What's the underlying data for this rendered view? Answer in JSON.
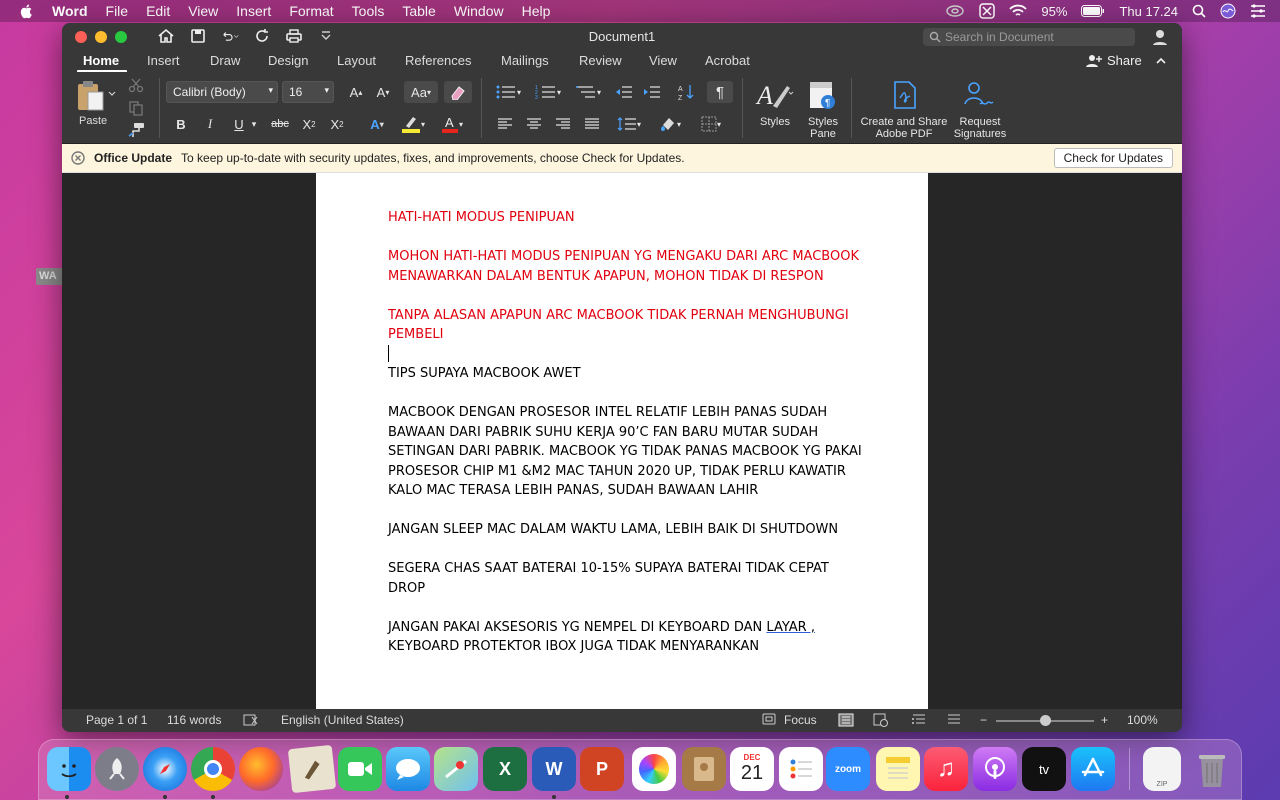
{
  "menubar": {
    "app": "Word",
    "items": [
      "File",
      "Edit",
      "View",
      "Insert",
      "Format",
      "Tools",
      "Table",
      "Window",
      "Help"
    ],
    "battery": "95%",
    "clock": "Thu 17.24"
  },
  "desktop_stub": "WA",
  "window": {
    "title": "Document1",
    "search_placeholder": "Search in Document"
  },
  "tabs": [
    "Home",
    "Insert",
    "Draw",
    "Design",
    "Layout",
    "References",
    "Mailings",
    "Review",
    "View",
    "Acrobat"
  ],
  "share_label": "Share",
  "ribbon": {
    "paste_label": "Paste",
    "font_name": "Calibri (Body)",
    "font_size": "16",
    "styles_label": "Styles",
    "styles_pane_label_1": "Styles",
    "styles_pane_label_2": "Pane",
    "adobe_label_1": "Create and Share",
    "adobe_label_2": "Adobe PDF",
    "sign_label_1": "Request",
    "sign_label_2": "Signatures"
  },
  "update_bar": {
    "title": "Office Update",
    "message": "To keep up-to-date with security updates, fixes, and improvements, choose Check for Updates.",
    "button": "Check for Updates"
  },
  "document": {
    "p1": "HATI-HATI MODUS PENIPUAN",
    "p2": "MOHON HATI-HATI MODUS PENIPUAN YG MENGAKU DARI ARC MACBOOK MENAWARKAN DALAM BENTUK APAPUN, MOHON TIDAK DI RESPON",
    "p3": "TANPA ALASAN APAPUN ARC MACBOOK TIDAK PERNAH MENGHUBUNGI PEMBELI",
    "p4": "TIPS SUPAYA MACBOOK AWET",
    "p5": "MACBOOK DENGAN PROSESOR INTEL RELATIF LEBIH PANAS SUDAH BAWAAN DARI PABRIK SUHU KERJA 90’C FAN BARU MUTAR SUDAH SETINGAN DARI PABRIK. MACBOOK YG TIDAK PANAS MACBOOK YG PAKAI PROSESOR CHIP M1 &M2 MAC TAHUN 2020 UP, TIDAK PERLU KAWATIR KALO MAC TERASA LEBIH PANAS, SUDAH BAWAAN LAHIR",
    "p6": "JANGAN SLEEP MAC DALAM WAKTU LAMA, LEBIH BAIK DI SHUTDOWN",
    "p7": "SEGERA CHAS SAAT BATERAI 10-15% SUPAYA BATERAI TIDAK CEPAT DROP",
    "p8a": "JANGAN PAKAI AKSESORIS YG NEMPEL DI KEYBOARD DAN ",
    "p8b": "LAYAR ,",
    "p8c": "KEYBOARD PROTEKTOR IBOX JUGA TIDAK MENYARANKAN",
    "text_color_red": "#e1000f"
  },
  "statusbar": {
    "page": "Page 1 of 1",
    "words": "116 words",
    "language": "English (United States)",
    "focus": "Focus",
    "zoom": "100%",
    "zoom_level_percent": 100
  },
  "dock": {
    "apps": [
      "Finder",
      "Launchpad",
      "Safari",
      "Chrome",
      "Firefox",
      "Mail",
      "FaceTime",
      "Messages",
      "Maps",
      "Excel",
      "Word",
      "PowerPoint",
      "Photos",
      "Contacts",
      "Calendar",
      "Reminders",
      "Zoom",
      "Notes",
      "Music",
      "Podcasts",
      "TV",
      "App Store",
      "Archive",
      "Trash"
    ],
    "calendar_month": "DEC",
    "calendar_day": "21",
    "zoom_label": "zoom",
    "tv_label": "tv",
    "zip_label": "ZIP"
  }
}
